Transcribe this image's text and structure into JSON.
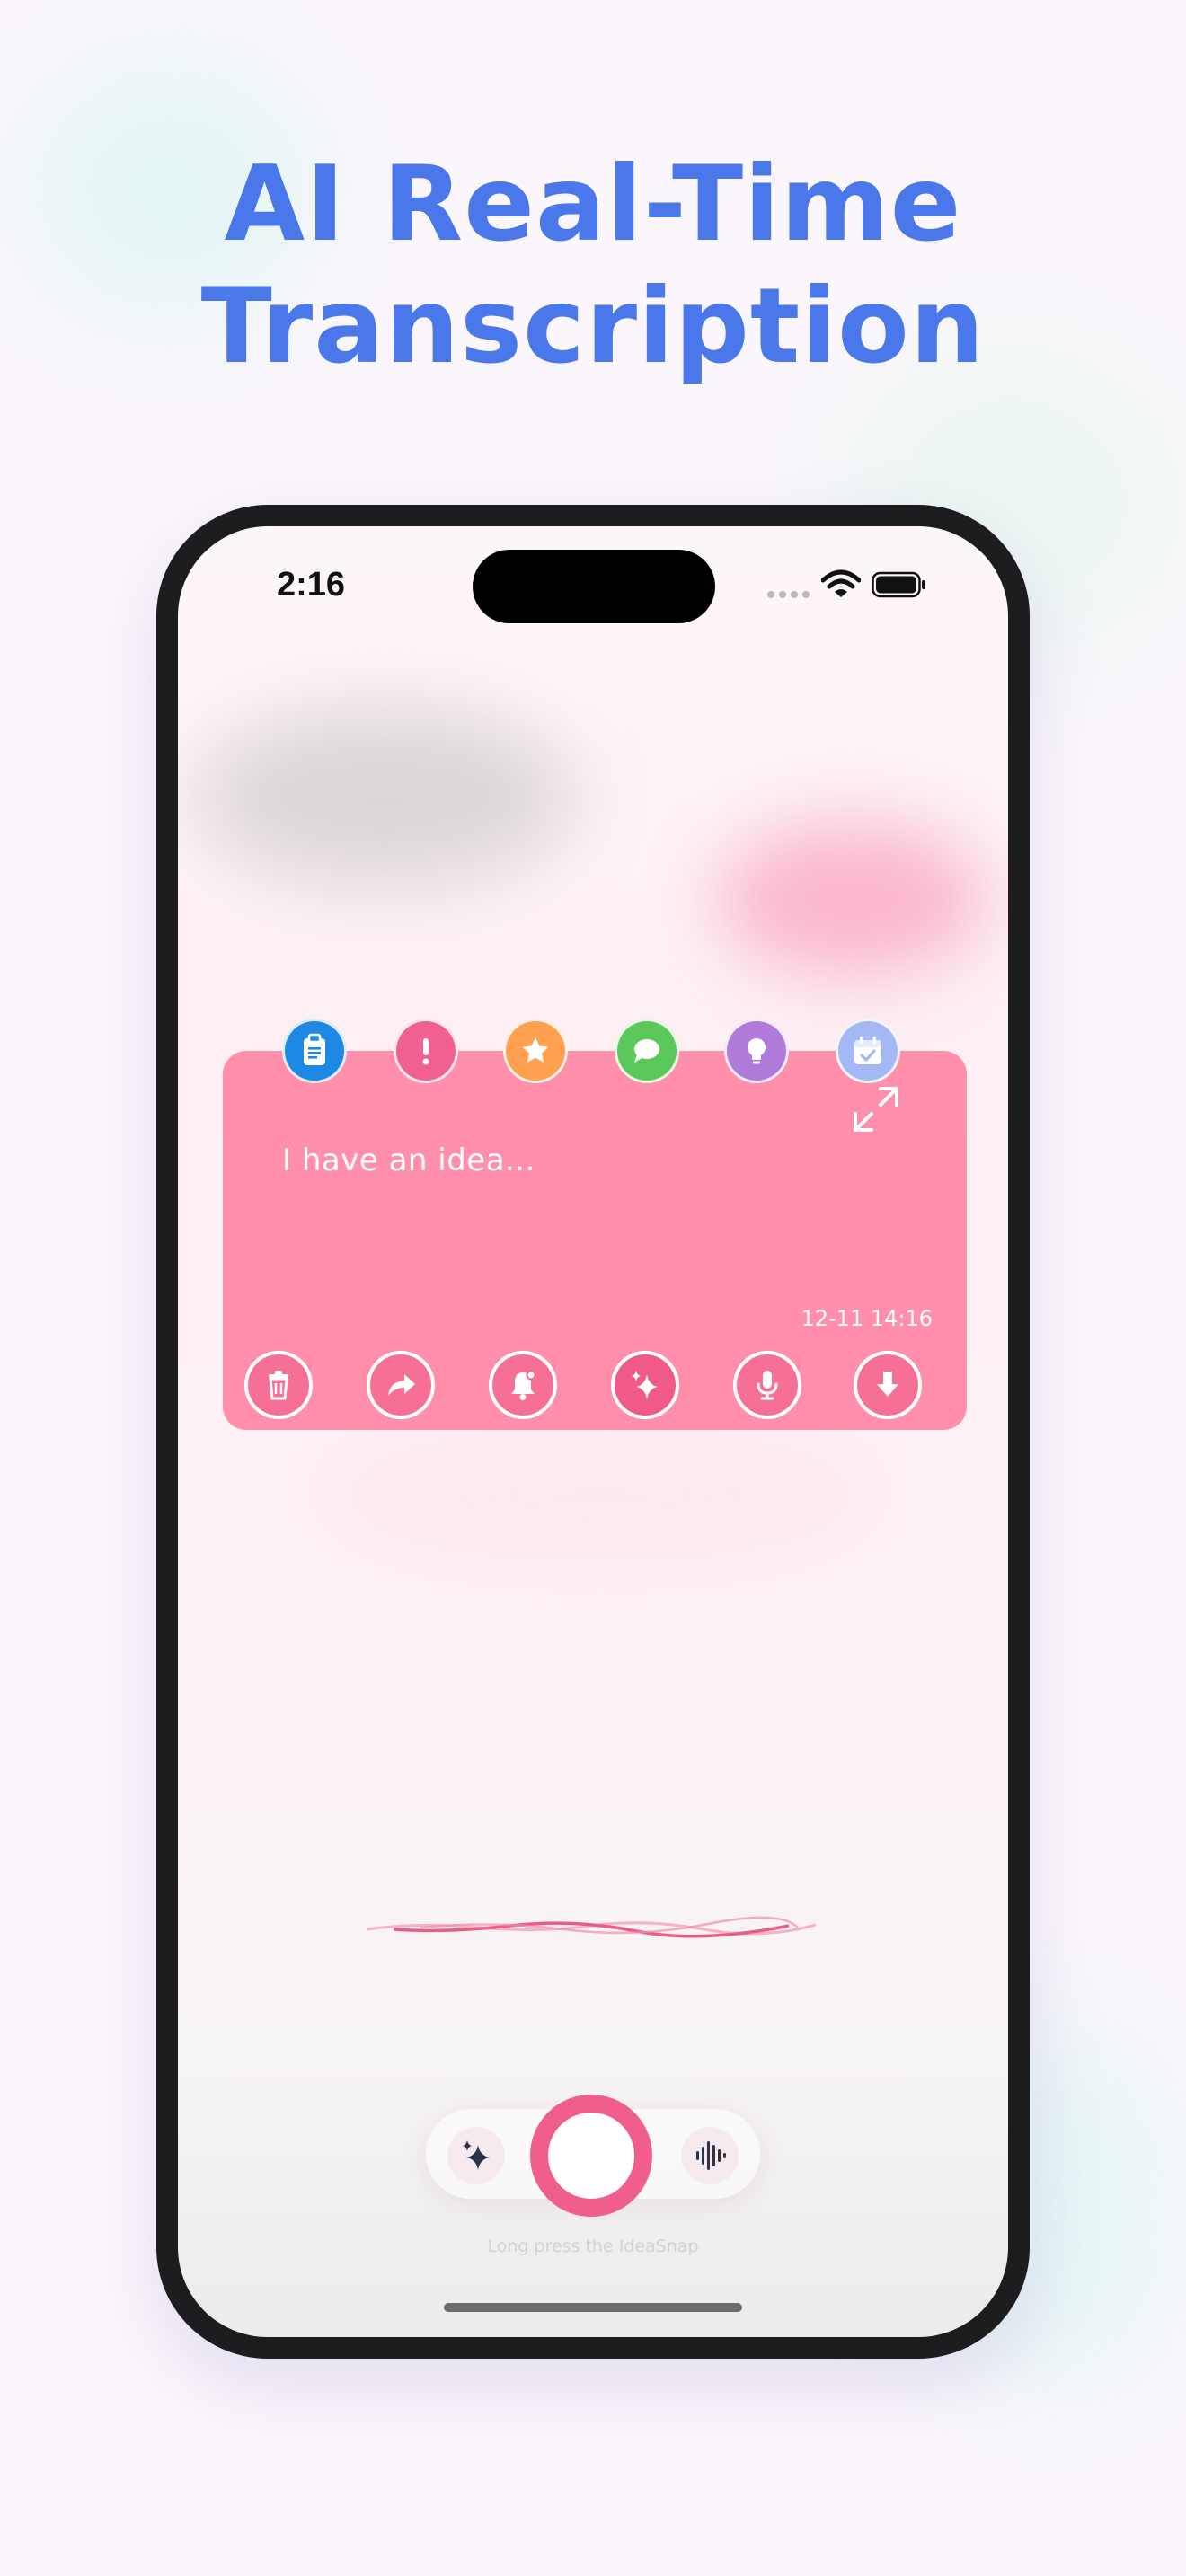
{
  "headline": {
    "line1": "AI Real-Time",
    "line2": "Transcription"
  },
  "status_bar": {
    "time": "2:16"
  },
  "note": {
    "text": "I have an idea...",
    "date": "12-11 14:16",
    "categories": [
      {
        "icon": "clipboard-icon",
        "color": "#1e88e5"
      },
      {
        "icon": "exclamation-icon",
        "color": "#f06090"
      },
      {
        "icon": "star-icon",
        "color": "#ffa150"
      },
      {
        "icon": "chat-bubble-icon",
        "color": "#5cc85c"
      },
      {
        "icon": "lightbulb-icon",
        "color": "#b07ad8"
      },
      {
        "icon": "calendar-check-icon",
        "color": "#a3b8f5"
      }
    ],
    "actions": [
      "trash-icon",
      "share-icon",
      "reminder-bell-icon",
      "ai-sparkle-icon",
      "microphone-icon",
      "download-icon"
    ]
  },
  "dock": {
    "left_icon": "sparkle-icon",
    "right_icon": "waveform-icon"
  },
  "hint": "Long press the IdeaSnap",
  "colors": {
    "headline": "#4a78ea",
    "card": "#ff8fab",
    "record": "#f05e8a"
  }
}
